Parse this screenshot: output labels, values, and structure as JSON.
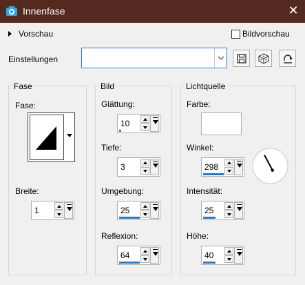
{
  "window": {
    "title": "Innenfase",
    "close_glyph": "✕"
  },
  "preview": {
    "toggle_label": "Vorschau",
    "bildvorschau_label": "Bildvorschau",
    "bildvorschau_checked": false
  },
  "einstellungen": {
    "label": "Einstellungen",
    "value": "",
    "buttons": [
      "save-icon",
      "dice-icon",
      "reset-icon"
    ]
  },
  "fase_group": {
    "title": "Fase",
    "fase_label": "Fase:",
    "breite_label": "Breite:",
    "breite_value": "1"
  },
  "bild_group": {
    "title": "Bild",
    "glaettung_label": "Glättung:",
    "glaettung_value": "10",
    "glaettung_fill": 0.1,
    "tiefe_label": "Tiefe:",
    "tiefe_value": "3",
    "tiefe_fill": 0.0,
    "umgebung_label": "Umgebung:",
    "umgebung_value": "25",
    "umgebung_fill": 1.0,
    "reflexion_label": "Reflexion:",
    "reflexion_value": "64",
    "reflexion_fill": 1.0
  },
  "licht_group": {
    "title": "Lichtquelle",
    "farbe_label": "Farbe:",
    "farbe_color": "#ffffff",
    "winkel_label": "Winkel:",
    "winkel_value": "298",
    "winkel_fill": 1.0,
    "intensitaet_label": "Intensität:",
    "intensitaet_value": "25",
    "intensitaet_fill": 0.6,
    "hoehe_label": "Höhe:",
    "hoehe_value": "40",
    "hoehe_fill": 0.6
  },
  "colors": {
    "titlebar": "#54291f",
    "accent": "#2b79c6",
    "dialog_bg": "#f0f0f0"
  }
}
